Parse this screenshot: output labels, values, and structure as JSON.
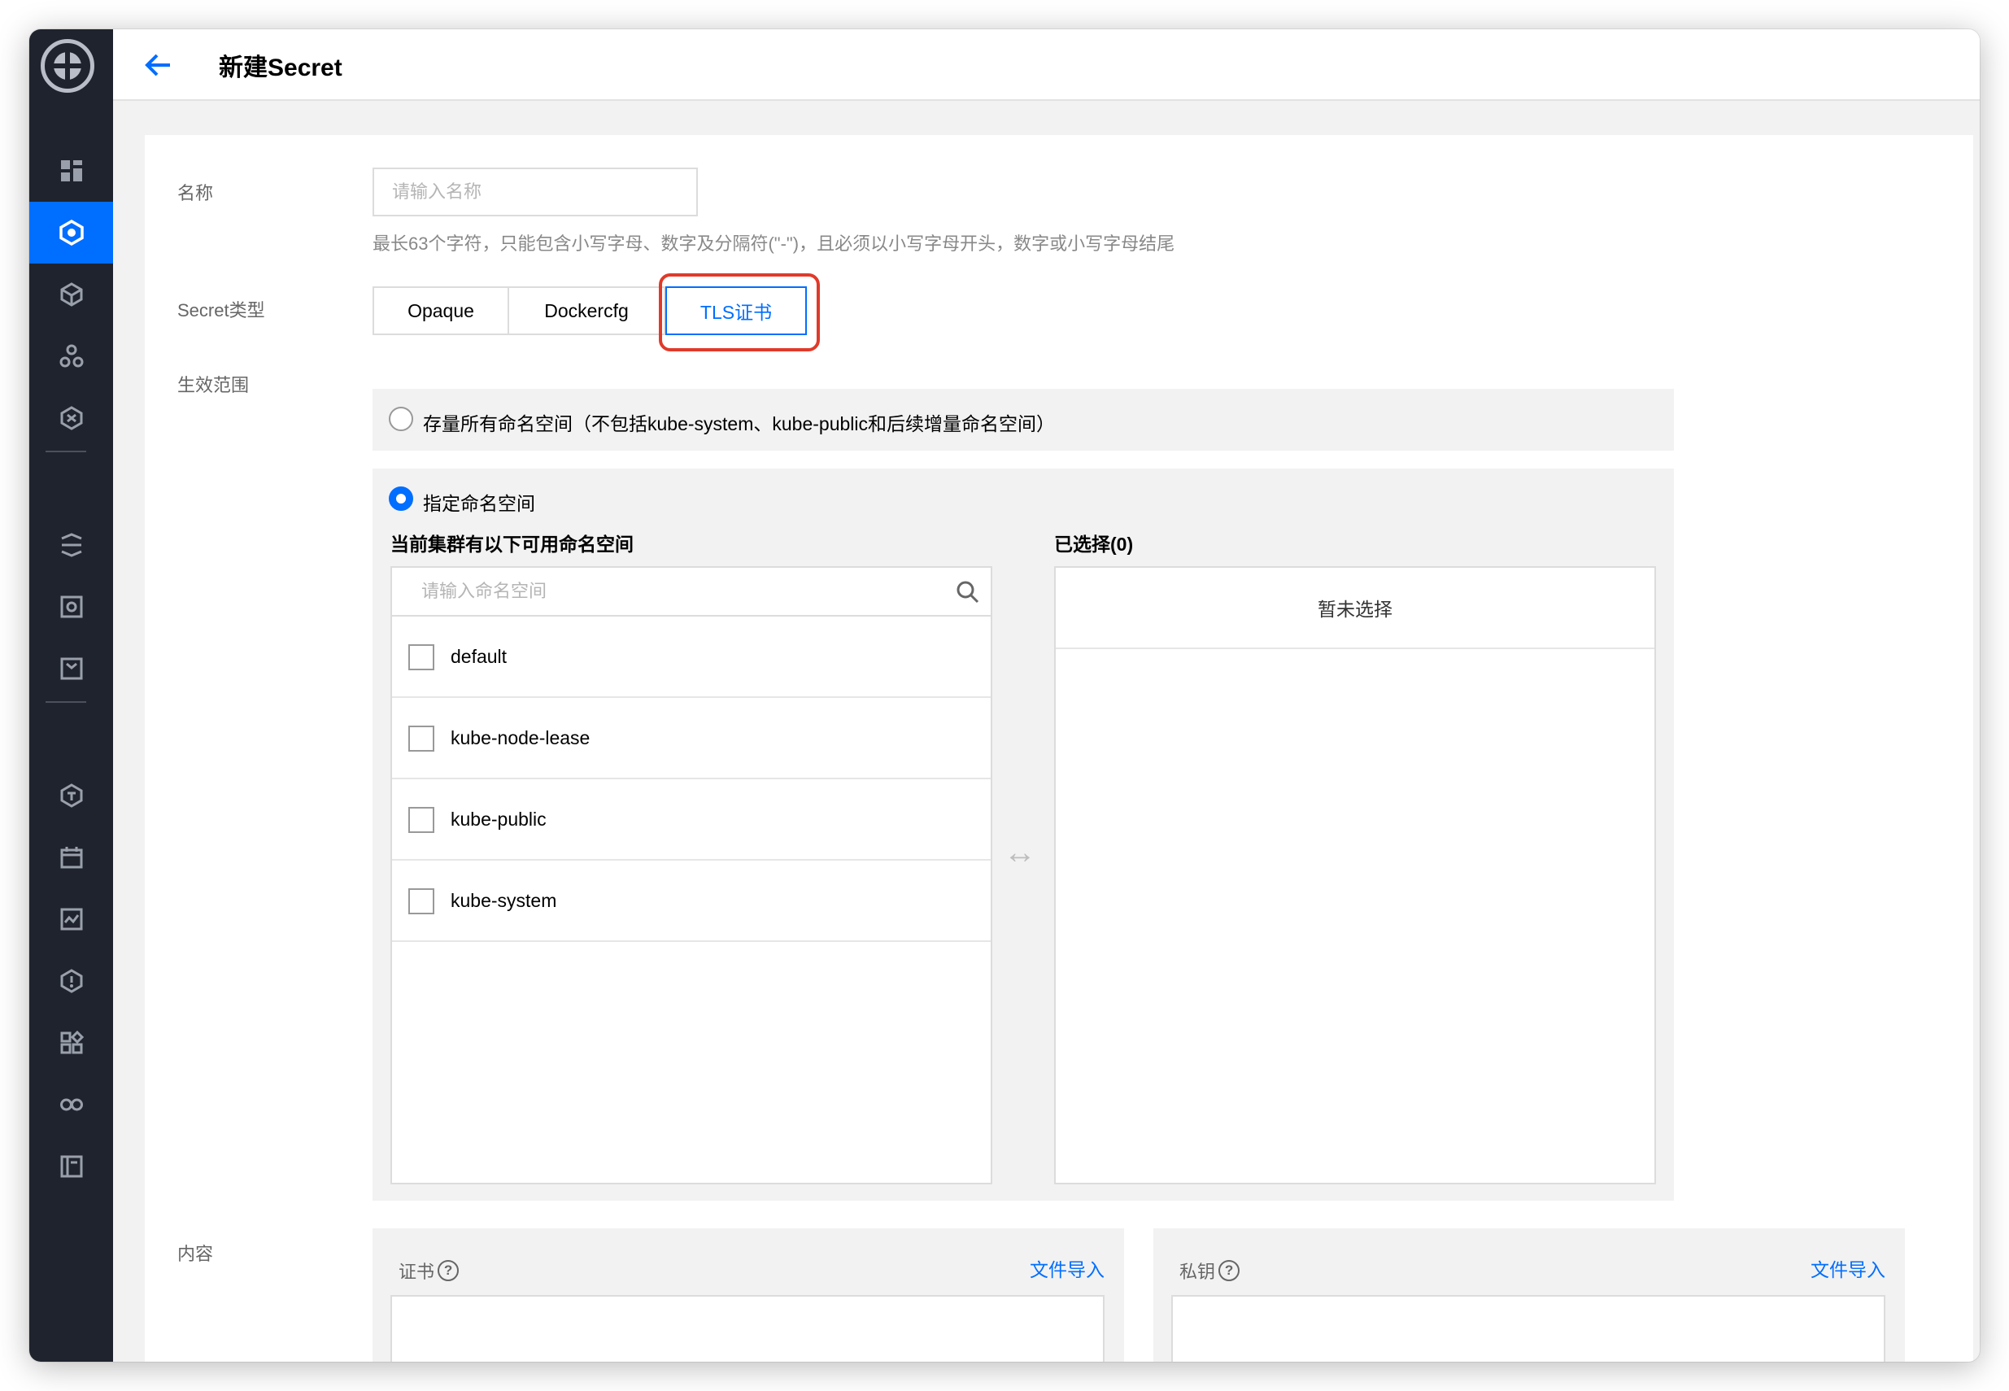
{
  "header": {
    "title": "新建Secret"
  },
  "sidebar": {
    "items": [
      "overview",
      "cluster",
      "services",
      "nodes",
      "network",
      "config",
      "storage",
      "package",
      "shield",
      "calendar",
      "monitor",
      "alarm",
      "apps",
      "infinity",
      "book"
    ],
    "active_index": 1
  },
  "form": {
    "name_label": "名称",
    "name_placeholder": "请输入名称",
    "name_hint": "最长63个字符，只能包含小写字母、数字及分隔符(\"-\")，且必须以小写字母开头，数字或小写字母结尾",
    "type_label": "Secret类型",
    "types": [
      "Opaque",
      "Dockercfg",
      "TLS证书"
    ],
    "selected_type": "TLS证书",
    "scope_label": "生效范围",
    "scope_all": "存量所有命名空间（不包括kube-system、kube-public和后续增量命名空间）",
    "scope_specific": "指定命名空间",
    "available_title": "当前集群有以下可用命名空间",
    "search_placeholder": "请输入命名空间",
    "namespaces": [
      "default",
      "kube-node-lease",
      "kube-public",
      "kube-system"
    ],
    "selected_title": "已选择(0)",
    "selected_empty": "暂未选择",
    "transfer_symbol": "↔",
    "content_label": "内容",
    "cert_label": "证书",
    "key_label": "私钥",
    "help_symbol": "?",
    "import_label": "文件导入"
  },
  "colors": {
    "accent": "#006eff",
    "highlight": "#e03a2a",
    "sidebar": "#1f232e"
  }
}
